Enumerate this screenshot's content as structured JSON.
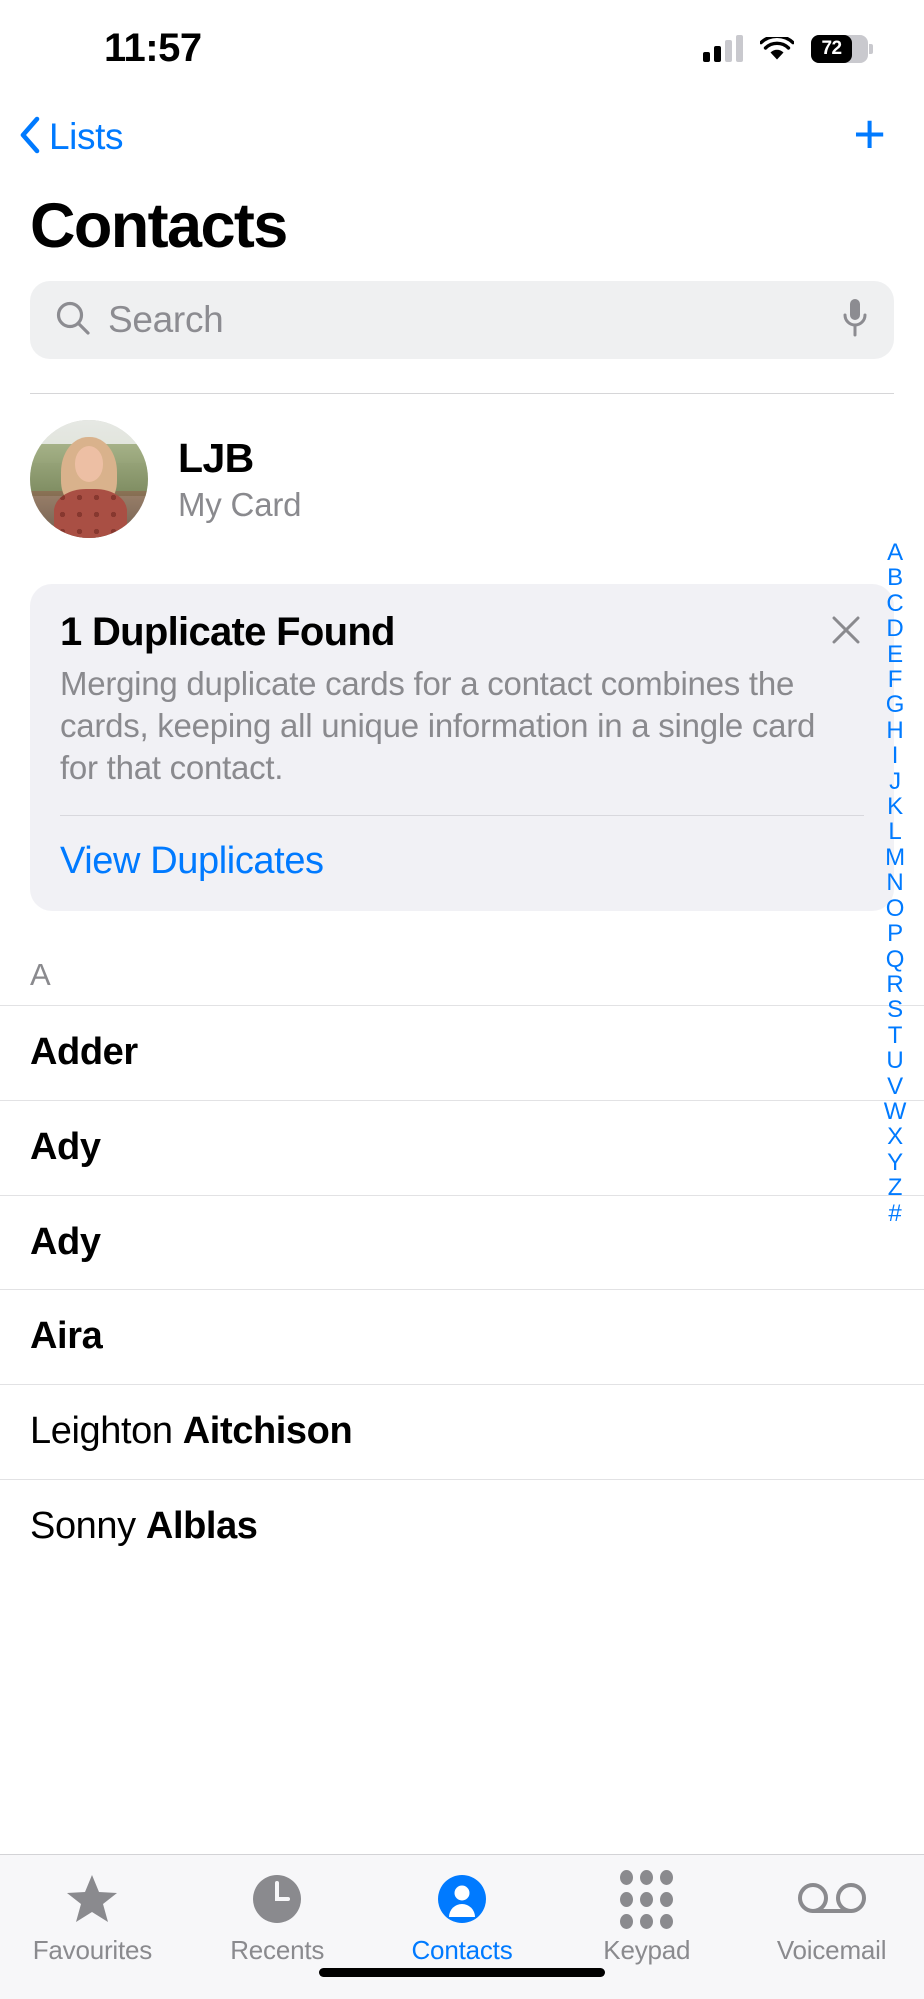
{
  "status_bar": {
    "time": "11:57",
    "battery_percent": "72",
    "icons": [
      "cellular-signal-icon",
      "wifi-icon",
      "battery-icon"
    ]
  },
  "nav": {
    "back_label": "Lists",
    "add_label": "+"
  },
  "header": {
    "title": "Contacts"
  },
  "search": {
    "placeholder": "Search",
    "value": ""
  },
  "my_card": {
    "name": "LJB",
    "subtitle": "My Card"
  },
  "duplicate_banner": {
    "title": "1 Duplicate Found",
    "body": "Merging duplicate cards for a contact combines the cards, keeping all unique information in a single card for that contact.",
    "link": "View Duplicates",
    "close_label": "×"
  },
  "contacts": {
    "section_header": "A",
    "rows": [
      {
        "first": "",
        "last": "Adder"
      },
      {
        "first": "",
        "last": "Ady"
      },
      {
        "first": "",
        "last": "Ady"
      },
      {
        "first": "",
        "last": "Aira"
      },
      {
        "first": "Leighton ",
        "last": "Aitchison"
      },
      {
        "first": "Sonny ",
        "last": "Alblas"
      }
    ]
  },
  "index_strip": {
    "letters": [
      "A",
      "B",
      "C",
      "D",
      "E",
      "F",
      "G",
      "H",
      "I",
      "J",
      "K",
      "L",
      "M",
      "N",
      "O",
      "P",
      "Q",
      "R",
      "S",
      "T",
      "U",
      "V",
      "W",
      "X",
      "Y",
      "Z",
      "#"
    ]
  },
  "tab_bar": {
    "tabs": [
      {
        "label": "Favourites",
        "icon": "star-icon",
        "active": false
      },
      {
        "label": "Recents",
        "icon": "clock-icon",
        "active": false
      },
      {
        "label": "Contacts",
        "icon": "person-circle-icon",
        "active": true
      },
      {
        "label": "Keypad",
        "icon": "keypad-icon",
        "active": false
      },
      {
        "label": "Voicemail",
        "icon": "voicemail-icon",
        "active": false
      }
    ]
  },
  "colors": {
    "accent": "#007aff",
    "banner_bg": "#f1f1f5",
    "search_bg": "#eff0f1",
    "secondary_text": "#8a8a8e"
  }
}
